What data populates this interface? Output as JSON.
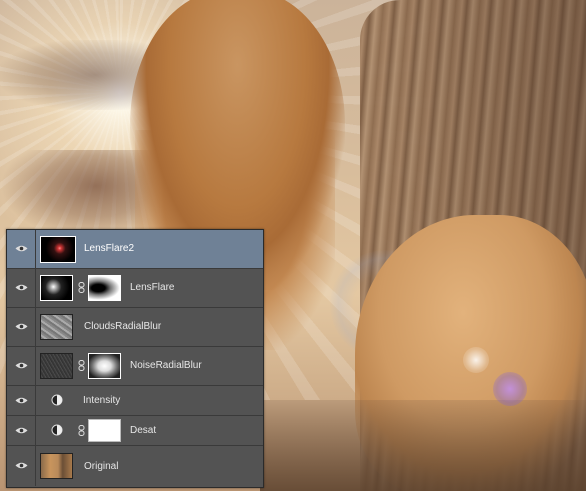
{
  "layers_panel": {
    "layers": [
      {
        "name": "LensFlare2",
        "selected": true,
        "visible": true,
        "kind": "pixel",
        "icons": [
          "eye-icon",
          "lens-flare-thumbnail"
        ]
      },
      {
        "name": "LensFlare",
        "selected": false,
        "visible": true,
        "kind": "pixel-with-mask",
        "icons": [
          "eye-icon",
          "lens-flare-thumbnail",
          "chain-link-icon",
          "layer-mask-thumbnail"
        ]
      },
      {
        "name": "CloudsRadialBlur",
        "selected": false,
        "visible": true,
        "kind": "pixel",
        "icons": [
          "eye-icon",
          "clouds-thumbnail"
        ]
      },
      {
        "name": "NoiseRadialBlur",
        "selected": false,
        "visible": true,
        "kind": "pixel-with-mask",
        "icons": [
          "eye-icon",
          "noise-thumbnail",
          "chain-link-icon",
          "layer-mask-thumbnail"
        ]
      },
      {
        "name": "Intensity",
        "selected": false,
        "visible": true,
        "kind": "adjustment",
        "icons": [
          "eye-icon",
          "adjustment-circle-icon"
        ]
      },
      {
        "name": "Desat",
        "selected": false,
        "visible": true,
        "kind": "adjustment-with-mask",
        "icons": [
          "eye-icon",
          "adjustment-circle-icon",
          "chain-link-icon",
          "white-mask-thumbnail"
        ]
      },
      {
        "name": "Original",
        "selected": false,
        "visible": true,
        "kind": "pixel",
        "icons": [
          "eye-icon",
          "photo-thumbnail"
        ]
      }
    ]
  },
  "colors": {
    "panel_bg": "#535353",
    "selected_row": "#6f8196",
    "text": "#e6e6e6"
  }
}
